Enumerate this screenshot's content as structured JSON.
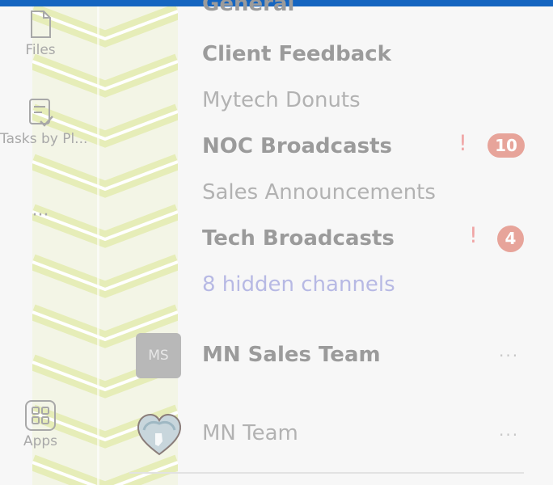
{
  "rail": {
    "files_label": "Files",
    "tasks_label": "Tasks by Pl...",
    "more_label": "···",
    "apps_label": "Apps"
  },
  "channels": [
    {
      "name": "General"
    },
    {
      "name": "Client Feedback"
    },
    {
      "name": "Mytech Donuts"
    },
    {
      "name": "NOC Broadcasts",
      "alert": "!",
      "badge": "10"
    },
    {
      "name": "Sales Announcements"
    },
    {
      "name": "Tech Broadcasts",
      "alert": "!",
      "badge": "4"
    }
  ],
  "hidden_channels": "8 hidden channels",
  "teams": [
    {
      "avatar": "MS",
      "name": "MN Sales Team",
      "more": "···"
    },
    {
      "name": "MN Team",
      "more": "···"
    }
  ],
  "colors": {
    "topbar": "#1565c0",
    "badge": "#e7a49a",
    "alert": "#f0a5a5",
    "link": "#b7b9e4",
    "stripe": "#e3ebb0"
  },
  "icons": [
    "file-icon",
    "tasks-icon",
    "apps-icon",
    "heart-avatar-icon"
  ]
}
